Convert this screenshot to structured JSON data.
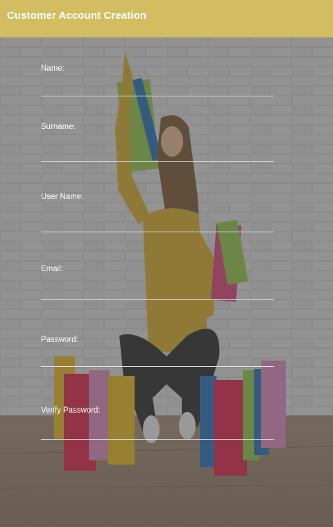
{
  "header": {
    "title": "Customer Account Creation"
  },
  "background": {
    "description_icon": "shopping-photo"
  },
  "form": {
    "fields": [
      {
        "label": "Name:",
        "value": "",
        "type": "text"
      },
      {
        "label": "Surname:",
        "value": "",
        "type": "text"
      },
      {
        "label": "User Name:",
        "value": "",
        "type": "text"
      },
      {
        "label": "Email:",
        "value": "",
        "type": "text"
      },
      {
        "label": "Password:",
        "value": "",
        "type": "password"
      },
      {
        "label": "Verify Password:",
        "value": "",
        "type": "password"
      }
    ]
  },
  "colors": {
    "header_bg": "#d3bd62",
    "text": "#ffffff",
    "underline": "#e6e6e6"
  }
}
